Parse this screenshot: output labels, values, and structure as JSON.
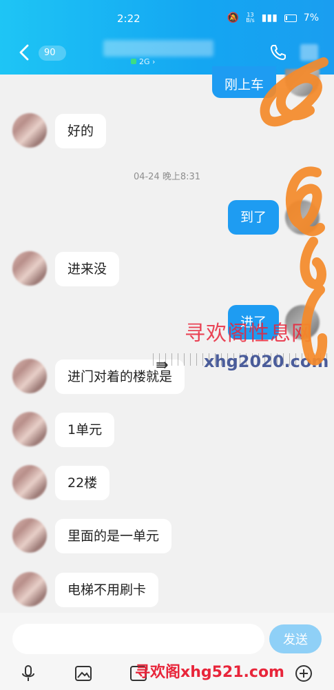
{
  "status_bar": {
    "time": "2:22",
    "net_speed_top": "13",
    "net_speed_unit": "B/s",
    "battery_pct": "7%"
  },
  "header": {
    "unread_count": "90",
    "contact_status": "2G"
  },
  "messages": [
    {
      "side": "out",
      "text": "刚上车"
    },
    {
      "side": "in",
      "text": "好的"
    },
    {
      "type": "time",
      "text": "04-24 晚上8:31"
    },
    {
      "side": "out",
      "text": "到了"
    },
    {
      "side": "in",
      "text": "进来没"
    },
    {
      "side": "out",
      "text": "进了"
    },
    {
      "side": "in",
      "text": "进门对着的楼就是"
    },
    {
      "side": "in",
      "text": "1单元"
    },
    {
      "side": "in",
      "text": "22楼"
    },
    {
      "side": "in",
      "text": "里面的是一单元"
    },
    {
      "side": "in",
      "text": "电梯不用刷卡"
    }
  ],
  "input": {
    "value": "",
    "send_label": "发送"
  },
  "toolbar": {
    "tools": [
      "microphone-icon",
      "image-icon",
      "gif-icon",
      "camera-icon",
      "red-packet-icon",
      "emoji-icon",
      "plus-icon"
    ]
  },
  "watermarks": {
    "site_cn": "寻欢阁性息网",
    "domain1": "xhg2020.com",
    "site_cn2": "寻欢阁",
    "domain2": "xhg521.com"
  },
  "colors": {
    "header_gradient_start": "#1ec5f5",
    "header_gradient_end": "#1a9ef0",
    "outgoing_bubble": "#1e9cf2",
    "incoming_bubble": "#ffffff",
    "send_button": "#8fd0f7",
    "scribble": "#f58a2a"
  }
}
